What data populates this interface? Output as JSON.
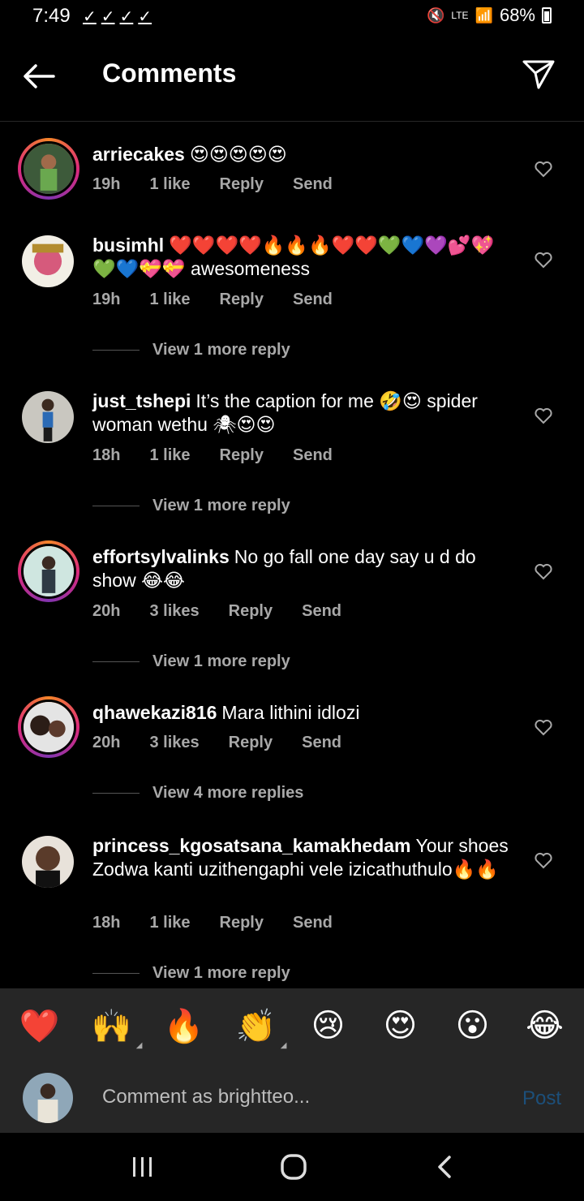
{
  "status_bar": {
    "time": "7:49",
    "checks": [
      "✓",
      "✓",
      "✓",
      "✓"
    ],
    "network": "LTE",
    "battery": "68%"
  },
  "header": {
    "title": "Comments"
  },
  "comments": [
    {
      "username": "arriecakes",
      "text": "😍😍😍😍😍",
      "time": "19h",
      "likes": "1 like",
      "reply": "Reply",
      "send": "Send"
    },
    {
      "username": "busimhl",
      "text": "❤️❤️❤️❤️🔥🔥🔥❤️❤️💚💙💜💕💖💚💙💝💝 awesomeness",
      "time": "19h",
      "likes": "1 like",
      "reply": "Reply",
      "send": "Send",
      "view_replies": "View 1 more reply"
    },
    {
      "username": "just_tshepi",
      "text": "It’s the caption for me 🤣😍 spider woman wethu 🕷😍😍",
      "time": "18h",
      "likes": "1 like",
      "reply": "Reply",
      "send": "Send",
      "view_replies": "View 1 more reply"
    },
    {
      "username": "effortsylvalinks",
      "text": "No go fall one day say u d do show 😂😂",
      "time": "20h",
      "likes": "3 likes",
      "reply": "Reply",
      "send": "Send",
      "view_replies": "View 1 more reply"
    },
    {
      "username": "qhawekazi816",
      "text": "Mara lithini idlozi",
      "time": "20h",
      "likes": "3 likes",
      "reply": "Reply",
      "send": "Send",
      "view_replies": "View 4 more replies"
    },
    {
      "username": "princess_kgosatsana_kamakhedam",
      "text": "Your shoes Zodwa kanti uzithengaphi vele izicathuthulo🔥🔥",
      "time": "18h",
      "likes": "1 like",
      "reply": "Reply",
      "send": "Send",
      "view_replies": "View 1 more reply"
    }
  ],
  "emoji_bar": [
    "❤️",
    "🙌",
    "🔥",
    "👏",
    "😢",
    "😍",
    "😮",
    "😂"
  ],
  "composer": {
    "placeholder": "Comment as brightteo...",
    "post_label": "Post"
  },
  "colors": {
    "background": "#000000",
    "secondary_text": "#a8a8a8",
    "panel": "#262626",
    "post_disabled": "#1c4f7a"
  }
}
